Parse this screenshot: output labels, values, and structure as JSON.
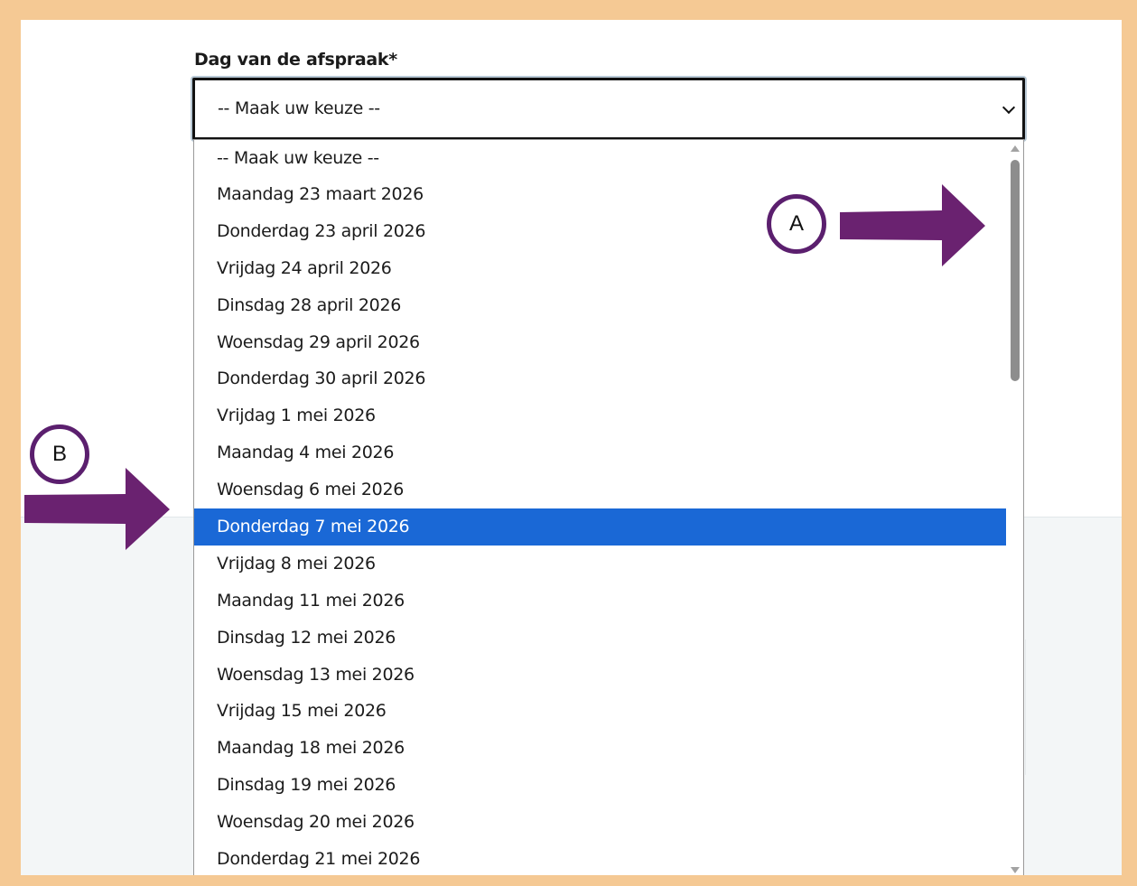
{
  "form": {
    "label": "Dag van de afspraak*",
    "select_value": "-- Maak uw keuze --"
  },
  "dropdown": {
    "options": [
      "-- Maak uw keuze --",
      "Maandag 23 maart 2026",
      "Donderdag 23 april 2026",
      "Vrijdag 24 april 2026",
      "Dinsdag 28 april 2026",
      "Woensdag 29 april 2026",
      "Donderdag 30 april 2026",
      "Vrijdag 1 mei 2026",
      "Maandag 4 mei 2026",
      "Woensdag 6 mei 2026",
      "Donderdag 7 mei 2026",
      "Vrijdag 8 mei 2026",
      "Maandag 11 mei 2026",
      "Dinsdag 12 mei 2026",
      "Woensdag 13 mei 2026",
      "Vrijdag 15 mei 2026",
      "Maandag 18 mei 2026",
      "Dinsdag 19 mei 2026",
      "Woensdag 20 mei 2026",
      "Donderdag 21 mei 2026"
    ],
    "highlighted_option": "Donderdag 7 mei 2026"
  },
  "annotations": {
    "a_label": "A",
    "b_label": "B"
  },
  "colors": {
    "border_frame": "#f5c994",
    "highlight": "#1a68d6",
    "annotation": "#6a2270"
  },
  "icons": {
    "select": "chevron-down-icon",
    "scroll_up": "triangle-up-icon",
    "scroll_down": "triangle-down-icon"
  }
}
